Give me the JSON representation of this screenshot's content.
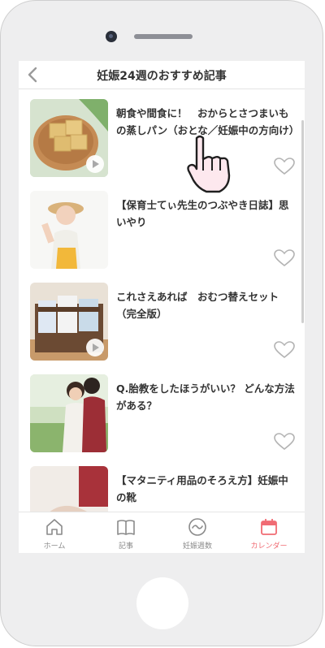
{
  "header": {
    "title": "妊娠24週のおすすめ記事"
  },
  "articles": [
    {
      "title": "朝食や間食に！　おからとさつまいもの蒸しパン（おとな／妊娠中の方向け）",
      "video": true
    },
    {
      "title": "【保育士てぃ先生のつぶやき日誌】思いやり",
      "video": false
    },
    {
      "title": "これさえあれば　おむつ替えセット（完全版）",
      "video": true
    },
    {
      "title": "Q.胎教をしたほうがいい？ どんな方法がある？",
      "video": false
    },
    {
      "title": "【マタニティ用品のそろえ方】妊娠中の靴",
      "video": false
    }
  ],
  "tabs": [
    {
      "label": "ホーム",
      "icon": "home-icon",
      "active": false
    },
    {
      "label": "記事",
      "icon": "book-icon",
      "active": false
    },
    {
      "label": "妊娠週数",
      "icon": "pregnancy-week-icon",
      "active": false
    },
    {
      "label": "カレンダー",
      "icon": "calendar-icon",
      "active": true
    }
  ],
  "colors": {
    "accent": "#f06b73",
    "text": "#333333",
    "icon_gray": "#8a8a8a"
  }
}
